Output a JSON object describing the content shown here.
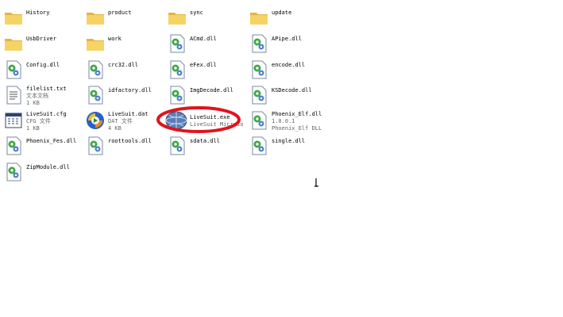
{
  "colors": {
    "highlight": "#e0141e",
    "folder": "#f6d365",
    "folder_dark": "#e5b43a",
    "gear_green": "#3da845"
  },
  "items": [
    {
      "name": "History",
      "icon": "folder-icon"
    },
    {
      "name": "product",
      "icon": "folder-icon"
    },
    {
      "name": "sync",
      "icon": "folder-icon"
    },
    {
      "name": "update",
      "icon": "folder-icon"
    },
    {
      "name": "UsbDriver",
      "icon": "folder-icon"
    },
    {
      "name": "work",
      "icon": "folder-icon"
    },
    {
      "name": "ACmd.dll",
      "icon": "dll-icon"
    },
    {
      "name": "APipe.dll",
      "icon": "dll-icon"
    },
    {
      "name": "Config.dll",
      "icon": "dll-icon"
    },
    {
      "name": "crc32.dll",
      "icon": "dll-icon"
    },
    {
      "name": "eFex.dll",
      "icon": "dll-icon"
    },
    {
      "name": "encode.dll",
      "icon": "dll-icon"
    },
    {
      "name": "filelist.txt",
      "icon": "text-file-icon",
      "line2": "文本文档",
      "line3": "1 KB"
    },
    {
      "name": "idfactory.dll",
      "icon": "dll-icon"
    },
    {
      "name": "ImgDecode.dll",
      "icon": "dll-icon"
    },
    {
      "name": "KSDecode.dll",
      "icon": "dll-icon"
    },
    {
      "name": "LiveSuit.cfg",
      "icon": "cfg-file-icon",
      "line2": "CFG 文件",
      "line3": "1 KB"
    },
    {
      "name": "LiveSuit.dat",
      "icon": "dat-file-icon",
      "line2": "DAT 文件",
      "line3": "4 KB"
    },
    {
      "name": "LiveSuit.exe",
      "icon": "livesuit-app-icon",
      "line2": "LiveSuit Microso"
    },
    {
      "name": "Phoenix_Elf.dll",
      "icon": "dll-icon",
      "line2": "1.0.0.1",
      "line3": "Phoenix_Elf DLL"
    },
    {
      "name": "Phoenix_Fes.dll",
      "icon": "dll-icon"
    },
    {
      "name": "roottools.dll",
      "icon": "dll-icon"
    },
    {
      "name": "sdata.dll",
      "icon": "dll-icon"
    },
    {
      "name": "single.dll",
      "icon": "dll-icon"
    },
    {
      "name": "ZipModule.dll",
      "icon": "dll-icon"
    }
  ]
}
